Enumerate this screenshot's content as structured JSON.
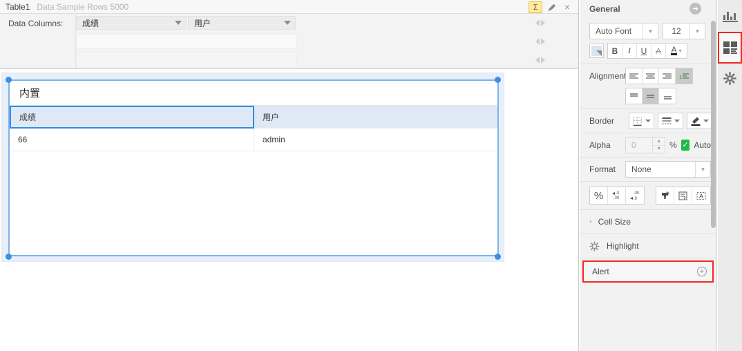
{
  "titlebar": {
    "table_name": "Table1",
    "subtitle": "Data Sample Rows 5000",
    "sigma_label": "Σ",
    "eraser_icon": "eraser-icon",
    "close_label": "×"
  },
  "data_columns": {
    "label": "Data Columns:",
    "fields": [
      {
        "value": "成绩"
      },
      {
        "value": "用户"
      }
    ]
  },
  "table_widget": {
    "title": "内置",
    "headers": [
      "成绩",
      "用户"
    ],
    "rows": [
      [
        "66",
        "admin"
      ]
    ]
  },
  "properties": {
    "header": "General",
    "font": {
      "name": "Auto Font",
      "size": "12"
    },
    "text_styles": {
      "bold": "B",
      "italic": "I",
      "underline": "U",
      "strike": "A",
      "font_color": "A",
      "font_color_caret": "▾"
    },
    "alignment": {
      "label": "Alignment",
      "horizontal": [
        "align-left",
        "align-center",
        "align-right",
        "align-auto"
      ],
      "vertical": [
        "align-top",
        "align-middle",
        "align-bottom"
      ],
      "selected_horizontal": "align-auto",
      "selected_vertical": "align-middle"
    },
    "border": {
      "label": "Border",
      "buttons": [
        "border-style-grid",
        "border-line-weight",
        "border-color"
      ]
    },
    "alpha": {
      "label": "Alpha",
      "value": "0",
      "placeholder": "0",
      "percent": "%",
      "auto_label": "Auto",
      "auto_checked": true,
      "check_glyph": "✓"
    },
    "format": {
      "label": "Format",
      "value": "None"
    },
    "number_buttons": [
      "percent-format",
      "decrease-decimal",
      "increase-decimal",
      "format-painter",
      "wrap-text",
      "text-box"
    ],
    "percent_glyph": "%",
    "sections": [
      {
        "name": "Cell Size",
        "label": "Cell Size",
        "chevron": "›"
      },
      {
        "name": "Highlight",
        "label": "Highlight",
        "icon": "gear-icon"
      }
    ],
    "alert": {
      "label": "Alert",
      "add_glyph": "+"
    }
  },
  "rail": {
    "items": [
      {
        "name": "chart-icon",
        "active": false
      },
      {
        "name": "layout-grid-icon",
        "active": true
      },
      {
        "name": "gear-icon",
        "active": false
      }
    ]
  },
  "colors": {
    "accent_blue": "#3d90e8",
    "header_blue": "#dfe9f5",
    "highlight_red": "#ee2a23",
    "check_green": "#21ba45",
    "sigma_yellow": "#ffe99a"
  }
}
